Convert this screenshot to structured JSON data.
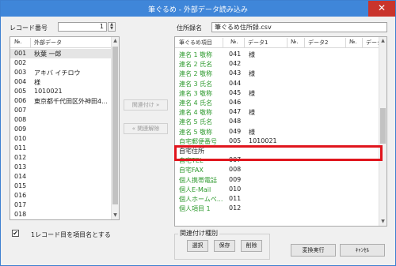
{
  "window": {
    "title": "筆ぐるめ - 外部データ読み込み",
    "close_glyph": "✕"
  },
  "record_no": {
    "label": "レコード番号",
    "value": "1"
  },
  "file": {
    "label": "住所録名",
    "value": "筆ぐるめ住所録.csv"
  },
  "left_table": {
    "columns": [
      "№.",
      "外部データ"
    ],
    "rows": [
      {
        "no": "001",
        "data": "秋葉 一郎"
      },
      {
        "no": "002",
        "data": ""
      },
      {
        "no": "003",
        "data": "アキバ イチロウ"
      },
      {
        "no": "004",
        "data": "様"
      },
      {
        "no": "005",
        "data": "1010021"
      },
      {
        "no": "006",
        "data": "東京都千代田区外神田4..."
      },
      {
        "no": "007",
        "data": ""
      },
      {
        "no": "008",
        "data": ""
      },
      {
        "no": "009",
        "data": ""
      },
      {
        "no": "010",
        "data": ""
      },
      {
        "no": "011",
        "data": ""
      },
      {
        "no": "012",
        "data": ""
      },
      {
        "no": "013",
        "data": ""
      },
      {
        "no": "014",
        "data": ""
      },
      {
        "no": "015",
        "data": ""
      },
      {
        "no": "016",
        "data": ""
      },
      {
        "no": "017",
        "data": ""
      },
      {
        "no": "018",
        "data": ""
      }
    ]
  },
  "middle": {
    "link_label": "関連付け »",
    "unlink_label": "« 関連解除"
  },
  "right_table": {
    "columns": [
      "筆ぐるめ項目",
      "№.",
      "データ1",
      "№.",
      "データ2",
      "№.",
      "データ"
    ],
    "rows": [
      {
        "item": "連名 1 敬称",
        "no": "041",
        "data1": "様"
      },
      {
        "item": "連名 2 氏名",
        "no": "042",
        "data1": ""
      },
      {
        "item": "連名 2 敬称",
        "no": "043",
        "data1": "様"
      },
      {
        "item": "連名 3 氏名",
        "no": "044",
        "data1": ""
      },
      {
        "item": "連名 3 敬称",
        "no": "045",
        "data1": "様"
      },
      {
        "item": "連名 4 氏名",
        "no": "046",
        "data1": ""
      },
      {
        "item": "連名 4 敬称",
        "no": "047",
        "data1": "様"
      },
      {
        "item": "連名 5 氏名",
        "no": "048",
        "data1": ""
      },
      {
        "item": "連名 5 敬称",
        "no": "049",
        "data1": "様"
      },
      {
        "item": "自宅郵便番号",
        "no": "005",
        "data1": "1010021"
      },
      {
        "item": "自宅住所",
        "no": "",
        "data1": ""
      },
      {
        "item": "自宅TEL",
        "no": "007",
        "data1": ""
      },
      {
        "item": "自宅FAX",
        "no": "008",
        "data1": ""
      },
      {
        "item": "個人携帯電話",
        "no": "009",
        "data1": ""
      },
      {
        "item": "個人E-Mail",
        "no": "010",
        "data1": ""
      },
      {
        "item": "個人ホームペ...",
        "no": "011",
        "data1": ""
      },
      {
        "item": "個人項目 1",
        "no": "012",
        "data1": ""
      }
    ]
  },
  "checkbox": {
    "label": "1レコード目を項目名とする",
    "checked": true,
    "mark": "✔"
  },
  "relation_group": {
    "label": "関連付け種別",
    "select": "選択",
    "save": "保存",
    "delete": "削除"
  },
  "actions": {
    "execute": "変換実行",
    "cancel": "ｷｬﾝｾﾙ"
  },
  "colors": {
    "title_bar": "#3f86d9",
    "close": "#c9342c",
    "green_item": "#2e9a2e",
    "highlight": "#e0151d"
  }
}
